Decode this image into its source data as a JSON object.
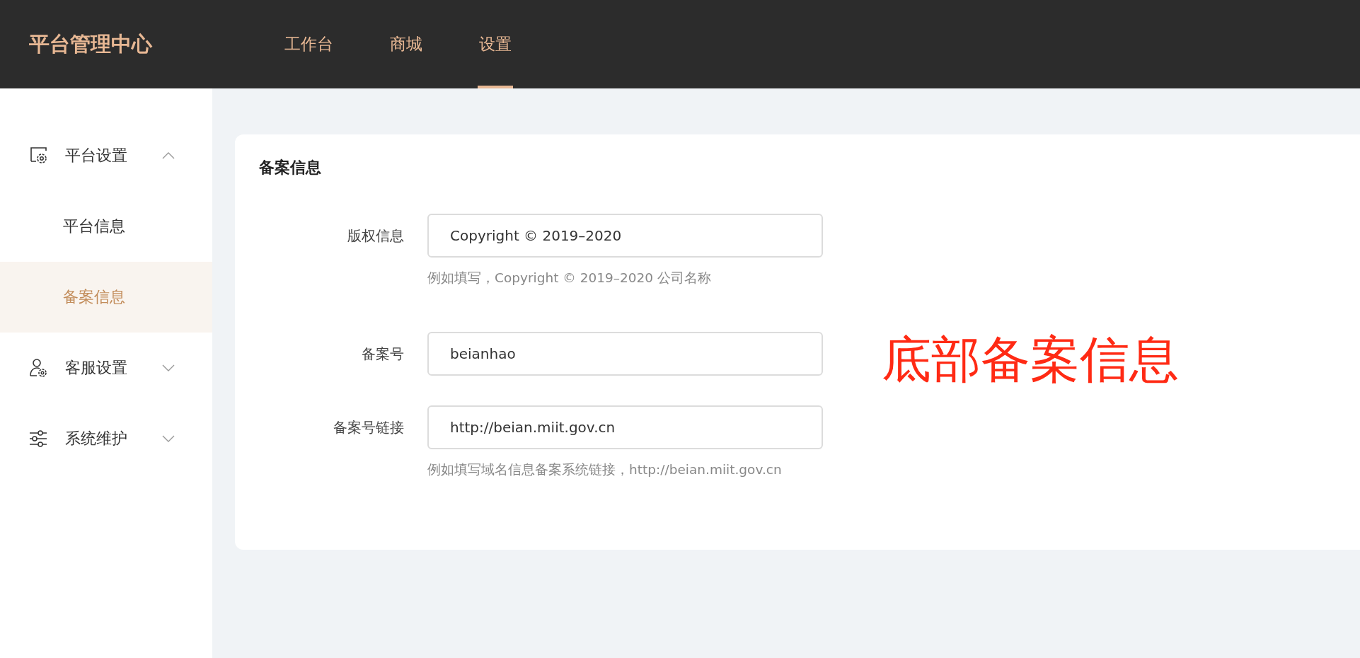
{
  "header": {
    "logo": "平台管理中心",
    "nav": [
      {
        "label": "工作台",
        "selected": false
      },
      {
        "label": "商城",
        "selected": false
      },
      {
        "label": "设置",
        "selected": true
      }
    ]
  },
  "sidebar": {
    "groups": [
      {
        "label": "平台设置",
        "expanded": true,
        "children": [
          {
            "label": "平台信息",
            "selected": false
          },
          {
            "label": "备案信息",
            "selected": true
          }
        ]
      },
      {
        "label": "客服设置",
        "expanded": false
      },
      {
        "label": "系统维护",
        "expanded": false
      }
    ]
  },
  "card": {
    "title": "备案信息",
    "fields": [
      {
        "label": "版权信息",
        "value": "Copyright © 2019–2020",
        "help": "例如填写，Copyright © 2019–2020 公司名称"
      },
      {
        "label": "备案号",
        "value": "beianhao"
      },
      {
        "label": "备案号链接",
        "value": "http://beian.miit.gov.cn",
        "help": "例如填写域名信息备案系统链接，http://beian.miit.gov.cn"
      }
    ]
  },
  "annotation": "底部备案信息"
}
